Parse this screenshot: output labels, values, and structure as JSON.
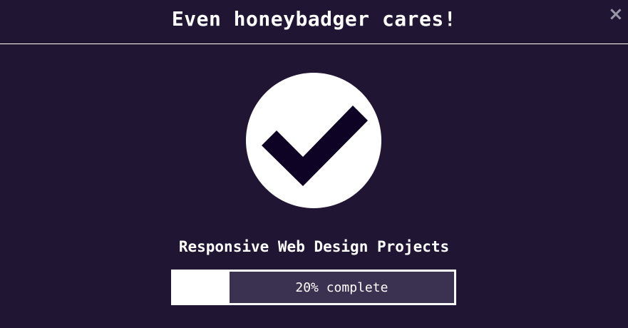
{
  "modal": {
    "title": "Even honeybadger cares!",
    "close_icon": "×",
    "close_icon_name": "close-icon"
  },
  "completion": {
    "icon": "checkmark-icon",
    "project_title": "Responsive Web Design Projects",
    "progress_percent": 20,
    "progress_label": "20% complete"
  },
  "colors": {
    "background": "#211534",
    "text": "#ffffff",
    "checkmark": "#0e0225",
    "progress_track": "#3b3150",
    "progress_fill": "#ffffff",
    "close_icon": "#9a95a6"
  }
}
